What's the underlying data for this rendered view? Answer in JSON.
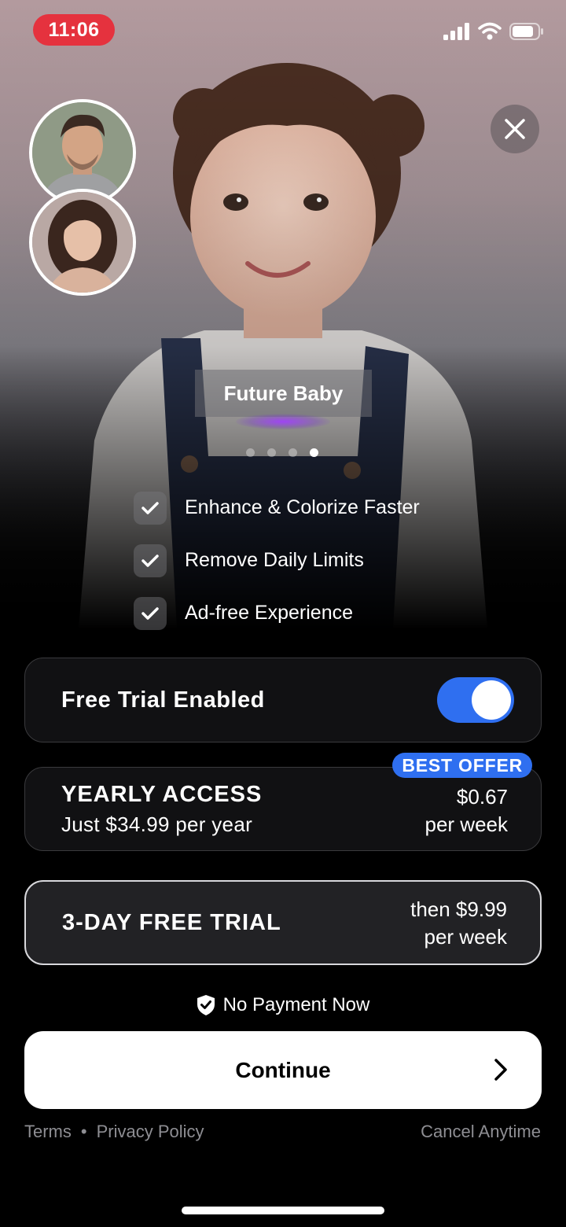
{
  "status_bar": {
    "time": "11:06"
  },
  "hero": {
    "label": "Future Baby",
    "page_count": 4,
    "active_page": 4
  },
  "features": [
    {
      "label": "Enhance & Colorize Faster"
    },
    {
      "label": "Remove Daily Limits"
    },
    {
      "label": "Ad-free Experience"
    }
  ],
  "trial_toggle": {
    "label": "Free Trial Enabled",
    "enabled": true
  },
  "plans": {
    "yearly": {
      "badge": "BEST OFFER",
      "name": "YEARLY ACCESS",
      "subtitle": "Just $34.99 per year",
      "price": "$0.67",
      "period": "per week"
    },
    "weekly": {
      "name": "3-DAY FREE TRIAL",
      "price": "then $9.99",
      "period": "per week",
      "selected": true
    }
  },
  "no_payment": {
    "label": "No Payment Now"
  },
  "cta": {
    "label": "Continue"
  },
  "footer": {
    "terms": "Terms",
    "separator": "•",
    "privacy": "Privacy Policy",
    "cancel": "Cancel Anytime"
  },
  "colors": {
    "accent": "#2f6ff0",
    "time_pill": "#e5323e",
    "background": "#000000"
  }
}
